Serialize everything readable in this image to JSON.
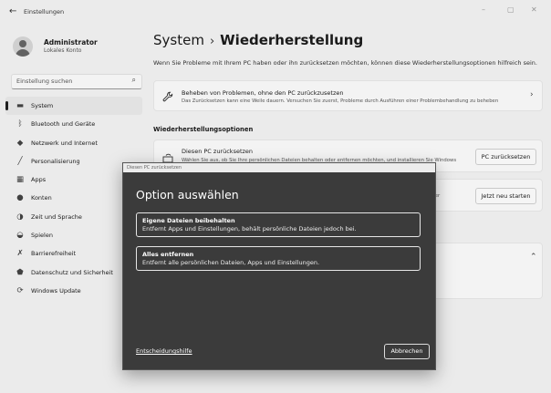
{
  "window": {
    "title": "Einstellungen",
    "back_icon": "←",
    "minimize": "–",
    "maximize": "▢",
    "close": "✕"
  },
  "profile": {
    "name": "Administrator",
    "account_type": "Lokales Konto"
  },
  "search": {
    "placeholder": "Einstellung suchen",
    "icon": "⌕"
  },
  "sidebar": {
    "items": [
      {
        "label": "System",
        "icon": "system-icon",
        "glyph": "▬",
        "active": true
      },
      {
        "label": "Bluetooth und Geräte",
        "icon": "bluetooth-icon",
        "glyph": "ᛒ"
      },
      {
        "label": "Netzwerk und Internet",
        "icon": "wifi-icon",
        "glyph": "◆"
      },
      {
        "label": "Personalisierung",
        "icon": "brush-icon",
        "glyph": "╱"
      },
      {
        "label": "Apps",
        "icon": "apps-icon",
        "glyph": "▦"
      },
      {
        "label": "Konten",
        "icon": "person-icon",
        "glyph": "●"
      },
      {
        "label": "Zeit und Sprache",
        "icon": "globe-icon",
        "glyph": "◑"
      },
      {
        "label": "Spielen",
        "icon": "gamepad-icon",
        "glyph": "◒"
      },
      {
        "label": "Barrierefreiheit",
        "icon": "accessibility-icon",
        "glyph": "✗"
      },
      {
        "label": "Datenschutz und Sicherheit",
        "icon": "shield-icon",
        "glyph": "⬟"
      },
      {
        "label": "Windows Update",
        "icon": "update-icon",
        "glyph": "⟳"
      }
    ]
  },
  "main": {
    "breadcrumb_parent": "System",
    "breadcrumb_sep": "›",
    "breadcrumb_current": "Wiederherstellung",
    "subtitle": "Wenn Sie Probleme mit Ihrem PC haben oder ihn zurücksetzen möchten, können diese Wiederherstellungsoptionen hilfreich sein.",
    "fix_card": {
      "title": "Beheben von Problemen, ohne den PC zurückzusetzen",
      "desc": "Das Zurücksetzen kann eine Weile dauern. Versuchen Sie zuerst, Probleme durch Ausführen einer Problembehandlung zu beheben",
      "chevron": "›"
    },
    "section_title": "Wiederherstellungsoptionen",
    "reset_card": {
      "title": "Diesen PC zurücksetzen",
      "desc": "Wählen Sie aus, ob Sie Ihre persönlichen Dateien behalten oder entfernen möchten, und installieren Sie Windows",
      "button": "PC zurücksetzen"
    },
    "advanced_card": {
      "partial_desc": "atenträger",
      "button": "Jetzt neu starten"
    },
    "help_card": {
      "chevron": "⌃"
    }
  },
  "dialog": {
    "window_title": "Diesen PC zurücksetzen",
    "heading": "Option auswählen",
    "options": [
      {
        "title": "Eigene Dateien beibehalten",
        "desc": "Entfernt Apps und Einstellungen, behält persönliche Dateien jedoch bei."
      },
      {
        "title": "Alles entfernen",
        "desc": "Entfernt alle persönlichen Dateien, Apps und Einstellungen."
      }
    ],
    "help_link": "Entscheidungshilfe",
    "cancel": "Abbrechen"
  }
}
